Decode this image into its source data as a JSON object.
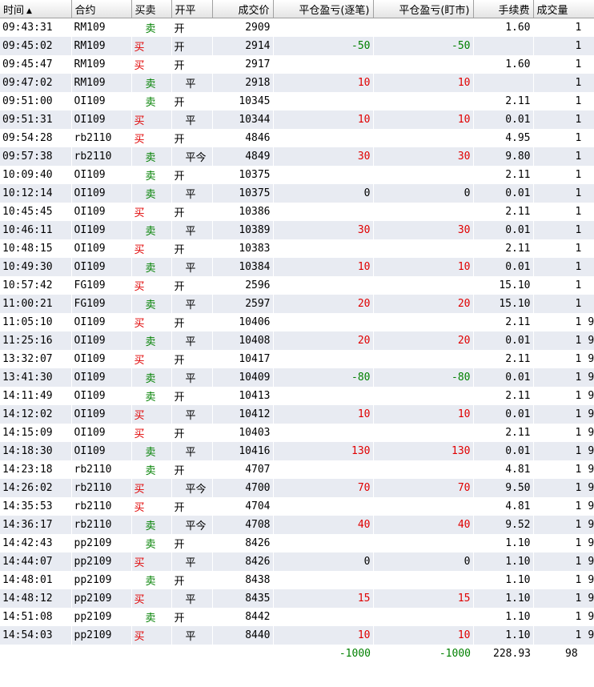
{
  "colors": {
    "buy": "#e00000",
    "sell": "#008000",
    "profit": "#e00000",
    "loss": "#008000"
  },
  "headers": [
    "时间",
    "合约",
    "买卖",
    "开平",
    "成交价",
    "平仓盈亏(逐笔)",
    "平仓盈亏(盯市)",
    "手续费",
    "成交量"
  ],
  "sort_indicator": "▲",
  "rows": [
    {
      "time": "09:43:31",
      "contract": "RM109",
      "side": "卖",
      "oc": "开",
      "price": "2909",
      "pnl_trade": "",
      "pnl_mtm": "",
      "fee": "1.60",
      "qty": "1",
      "extra": ""
    },
    {
      "time": "09:45:02",
      "contract": "RM109",
      "side": "买",
      "oc": "开",
      "price": "2914",
      "pnl_trade": "-50",
      "pnl_mtm": "-50",
      "fee": "",
      "qty": "1",
      "extra": ""
    },
    {
      "time": "09:45:47",
      "contract": "RM109",
      "side": "买",
      "oc": "开",
      "price": "2917",
      "pnl_trade": "",
      "pnl_mtm": "",
      "fee": "1.60",
      "qty": "1",
      "extra": ""
    },
    {
      "time": "09:47:02",
      "contract": "RM109",
      "side": "卖",
      "oc": "平",
      "price": "2918",
      "pnl_trade": "10",
      "pnl_mtm": "10",
      "fee": "",
      "qty": "1",
      "extra": ""
    },
    {
      "time": "09:51:00",
      "contract": "OI109",
      "side": "卖",
      "oc": "开",
      "price": "10345",
      "pnl_trade": "",
      "pnl_mtm": "",
      "fee": "2.11",
      "qty": "1",
      "extra": ""
    },
    {
      "time": "09:51:31",
      "contract": "OI109",
      "side": "买",
      "oc": "平",
      "price": "10344",
      "pnl_trade": "10",
      "pnl_mtm": "10",
      "fee": "0.01",
      "qty": "1",
      "extra": ""
    },
    {
      "time": "09:54:28",
      "contract": "rb2110",
      "side": "买",
      "oc": "开",
      "price": "4846",
      "pnl_trade": "",
      "pnl_mtm": "",
      "fee": "4.95",
      "qty": "1",
      "extra": ""
    },
    {
      "time": "09:57:38",
      "contract": "rb2110",
      "side": "卖",
      "oc": "平今",
      "price": "4849",
      "pnl_trade": "30",
      "pnl_mtm": "30",
      "fee": "9.80",
      "qty": "1",
      "extra": ""
    },
    {
      "time": "10:09:40",
      "contract": "OI109",
      "side": "卖",
      "oc": "开",
      "price": "10375",
      "pnl_trade": "",
      "pnl_mtm": "",
      "fee": "2.11",
      "qty": "1",
      "extra": ""
    },
    {
      "time": "10:12:14",
      "contract": "OI109",
      "side": "卖",
      "oc": "平",
      "price": "10375",
      "pnl_trade": "0",
      "pnl_mtm": "0",
      "fee": "0.01",
      "qty": "1",
      "extra": ""
    },
    {
      "time": "10:45:45",
      "contract": "OI109",
      "side": "买",
      "oc": "开",
      "price": "10386",
      "pnl_trade": "",
      "pnl_mtm": "",
      "fee": "2.11",
      "qty": "1",
      "extra": ""
    },
    {
      "time": "10:46:11",
      "contract": "OI109",
      "side": "卖",
      "oc": "平",
      "price": "10389",
      "pnl_trade": "30",
      "pnl_mtm": "30",
      "fee": "0.01",
      "qty": "1",
      "extra": ""
    },
    {
      "time": "10:48:15",
      "contract": "OI109",
      "side": "买",
      "oc": "开",
      "price": "10383",
      "pnl_trade": "",
      "pnl_mtm": "",
      "fee": "2.11",
      "qty": "1",
      "extra": ""
    },
    {
      "time": "10:49:30",
      "contract": "OI109",
      "side": "卖",
      "oc": "平",
      "price": "10384",
      "pnl_trade": "10",
      "pnl_mtm": "10",
      "fee": "0.01",
      "qty": "1",
      "extra": ""
    },
    {
      "time": "10:57:42",
      "contract": "FG109",
      "side": "买",
      "oc": "开",
      "price": "2596",
      "pnl_trade": "",
      "pnl_mtm": "",
      "fee": "15.10",
      "qty": "1",
      "extra": ""
    },
    {
      "time": "11:00:21",
      "contract": "FG109",
      "side": "卖",
      "oc": "平",
      "price": "2597",
      "pnl_trade": "20",
      "pnl_mtm": "20",
      "fee": "15.10",
      "qty": "1",
      "extra": ""
    },
    {
      "time": "11:05:10",
      "contract": "OI109",
      "side": "买",
      "oc": "开",
      "price": "10406",
      "pnl_trade": "",
      "pnl_mtm": "",
      "fee": "2.11",
      "qty": "1",
      "extra": "9"
    },
    {
      "time": "11:25:16",
      "contract": "OI109",
      "side": "卖",
      "oc": "平",
      "price": "10408",
      "pnl_trade": "20",
      "pnl_mtm": "20",
      "fee": "0.01",
      "qty": "1",
      "extra": "9"
    },
    {
      "time": "13:32:07",
      "contract": "OI109",
      "side": "买",
      "oc": "开",
      "price": "10417",
      "pnl_trade": "",
      "pnl_mtm": "",
      "fee": "2.11",
      "qty": "1",
      "extra": "9"
    },
    {
      "time": "13:41:30",
      "contract": "OI109",
      "side": "卖",
      "oc": "平",
      "price": "10409",
      "pnl_trade": "-80",
      "pnl_mtm": "-80",
      "fee": "0.01",
      "qty": "1",
      "extra": "9"
    },
    {
      "time": "14:11:49",
      "contract": "OI109",
      "side": "卖",
      "oc": "开",
      "price": "10413",
      "pnl_trade": "",
      "pnl_mtm": "",
      "fee": "2.11",
      "qty": "1",
      "extra": "9"
    },
    {
      "time": "14:12:02",
      "contract": "OI109",
      "side": "买",
      "oc": "平",
      "price": "10412",
      "pnl_trade": "10",
      "pnl_mtm": "10",
      "fee": "0.01",
      "qty": "1",
      "extra": "9"
    },
    {
      "time": "14:15:09",
      "contract": "OI109",
      "side": "买",
      "oc": "开",
      "price": "10403",
      "pnl_trade": "",
      "pnl_mtm": "",
      "fee": "2.11",
      "qty": "1",
      "extra": "9"
    },
    {
      "time": "14:18:30",
      "contract": "OI109",
      "side": "卖",
      "oc": "平",
      "price": "10416",
      "pnl_trade": "130",
      "pnl_mtm": "130",
      "fee": "0.01",
      "qty": "1",
      "extra": "9"
    },
    {
      "time": "14:23:18",
      "contract": "rb2110",
      "side": "卖",
      "oc": "开",
      "price": "4707",
      "pnl_trade": "",
      "pnl_mtm": "",
      "fee": "4.81",
      "qty": "1",
      "extra": "9"
    },
    {
      "time": "14:26:02",
      "contract": "rb2110",
      "side": "买",
      "oc": "平今",
      "price": "4700",
      "pnl_trade": "70",
      "pnl_mtm": "70",
      "fee": "9.50",
      "qty": "1",
      "extra": "9"
    },
    {
      "time": "14:35:53",
      "contract": "rb2110",
      "side": "买",
      "oc": "开",
      "price": "4704",
      "pnl_trade": "",
      "pnl_mtm": "",
      "fee": "4.81",
      "qty": "1",
      "extra": "9"
    },
    {
      "time": "14:36:17",
      "contract": "rb2110",
      "side": "卖",
      "oc": "平今",
      "price": "4708",
      "pnl_trade": "40",
      "pnl_mtm": "40",
      "fee": "9.52",
      "qty": "1",
      "extra": "9"
    },
    {
      "time": "14:42:43",
      "contract": "pp2109",
      "side": "卖",
      "oc": "开",
      "price": "8426",
      "pnl_trade": "",
      "pnl_mtm": "",
      "fee": "1.10",
      "qty": "1",
      "extra": "9"
    },
    {
      "time": "14:44:07",
      "contract": "pp2109",
      "side": "买",
      "oc": "平",
      "price": "8426",
      "pnl_trade": "0",
      "pnl_mtm": "0",
      "fee": "1.10",
      "qty": "1",
      "extra": "9"
    },
    {
      "time": "14:48:01",
      "contract": "pp2109",
      "side": "卖",
      "oc": "开",
      "price": "8438",
      "pnl_trade": "",
      "pnl_mtm": "",
      "fee": "1.10",
      "qty": "1",
      "extra": "9"
    },
    {
      "time": "14:48:12",
      "contract": "pp2109",
      "side": "买",
      "oc": "平",
      "price": "8435",
      "pnl_trade": "15",
      "pnl_mtm": "15",
      "fee": "1.10",
      "qty": "1",
      "extra": "9"
    },
    {
      "time": "14:51:08",
      "contract": "pp2109",
      "side": "卖",
      "oc": "开",
      "price": "8442",
      "pnl_trade": "",
      "pnl_mtm": "",
      "fee": "1.10",
      "qty": "1",
      "extra": "9"
    },
    {
      "time": "14:54:03",
      "contract": "pp2109",
      "side": "买",
      "oc": "平",
      "price": "8440",
      "pnl_trade": "10",
      "pnl_mtm": "10",
      "fee": "1.10",
      "qty": "1",
      "extra": "9"
    }
  ],
  "totals": {
    "pnl_trade": "-1000",
    "pnl_mtm": "-1000",
    "fee": "228.93",
    "qty": "98"
  }
}
